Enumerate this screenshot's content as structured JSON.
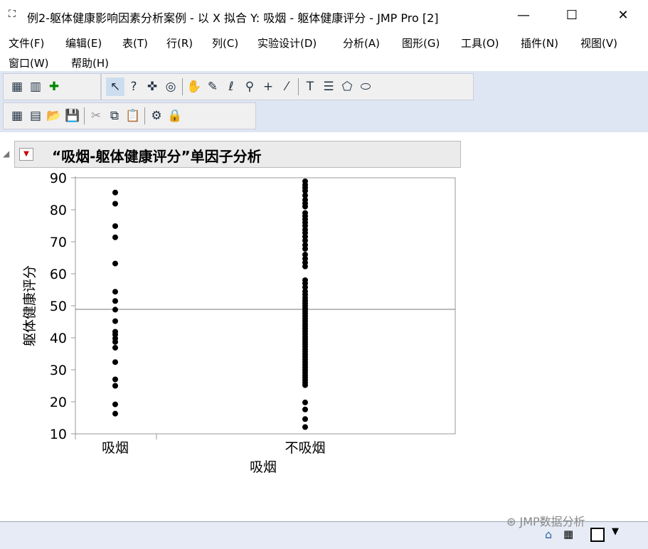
{
  "window": {
    "title": "例2-躯体健康影响因素分析案例 - 以 X 拟合 Y: 吸烟 - 躯体健康评分 - JMP Pro [2]",
    "minimize": "—",
    "maximize": "☐",
    "close": "✕"
  },
  "menu": [
    "文件(F)",
    "编辑(E)",
    "表(T)",
    "行(R)",
    "列(C)",
    "实验设计(D)",
    "分析(A)",
    "图形(G)",
    "工具(O)",
    "插件(N)",
    "视图(V)",
    "窗口(W)",
    "帮助(H)"
  ],
  "toolbar1": [
    "data-table-icon",
    "report-icon",
    "add-icon",
    "arrow-select-icon",
    "help-icon",
    "crosshair-icon",
    "target-icon",
    "hand-icon",
    "brush-icon",
    "lasso-icon",
    "magnifier-icon",
    "plus-icon",
    "ruler-icon",
    "text-icon",
    "lines-icon",
    "polygon-icon",
    "ellipse-icon"
  ],
  "toolbar2": [
    "new-table-icon",
    "new-script-icon",
    "open-icon",
    "save-icon",
    "cut-icon",
    "copy-icon",
    "paste-icon",
    "settings-icon",
    "lock-icon"
  ],
  "report": {
    "title": "“吸烟-躯体健康评分”单因子分析"
  },
  "status": {
    "watermark": "JMP数据分析"
  },
  "chart_data": {
    "type": "scatter",
    "xlabel": "吸烟",
    "ylabel": "躯体健康评分",
    "categories": [
      "吸烟",
      "不吸烟"
    ],
    "ylim": [
      10,
      90
    ],
    "yticks": [
      10,
      20,
      30,
      40,
      50,
      60,
      70,
      80,
      90
    ],
    "reference_line": 48.9,
    "series": [
      {
        "name": "吸烟",
        "values": [
          85.4,
          81.9,
          74.9,
          71.4,
          63.2,
          54.4,
          51.5,
          48.8,
          45.2,
          41.9,
          41,
          39.8,
          38.7,
          36.9,
          32.4,
          27,
          25,
          19.2,
          16.3
        ]
      },
      {
        "name": "不吸烟",
        "values": [
          88.9,
          87.8,
          86.9,
          85.9,
          84.5,
          83.1,
          82,
          81,
          79,
          78,
          77,
          76,
          75,
          73.8,
          72.8,
          71.6,
          70.4,
          69,
          67.8,
          66,
          64.7,
          63.5,
          62.3,
          58,
          57,
          55.8,
          54.5,
          53.5,
          52.5,
          51.6,
          50.8,
          50,
          49.2,
          48.4,
          47.6,
          46.8,
          46,
          45.2,
          44.4,
          43.6,
          42.8,
          42,
          41.2,
          40.4,
          39.6,
          38.8,
          38,
          37.2,
          36.4,
          35.6,
          34.8,
          34,
          33.2,
          32.4,
          31.6,
          30.8,
          30,
          29.2,
          28.4,
          27.6,
          26.8,
          26,
          25.2,
          19.8,
          17.6,
          14.6,
          12.1
        ]
      }
    ]
  }
}
